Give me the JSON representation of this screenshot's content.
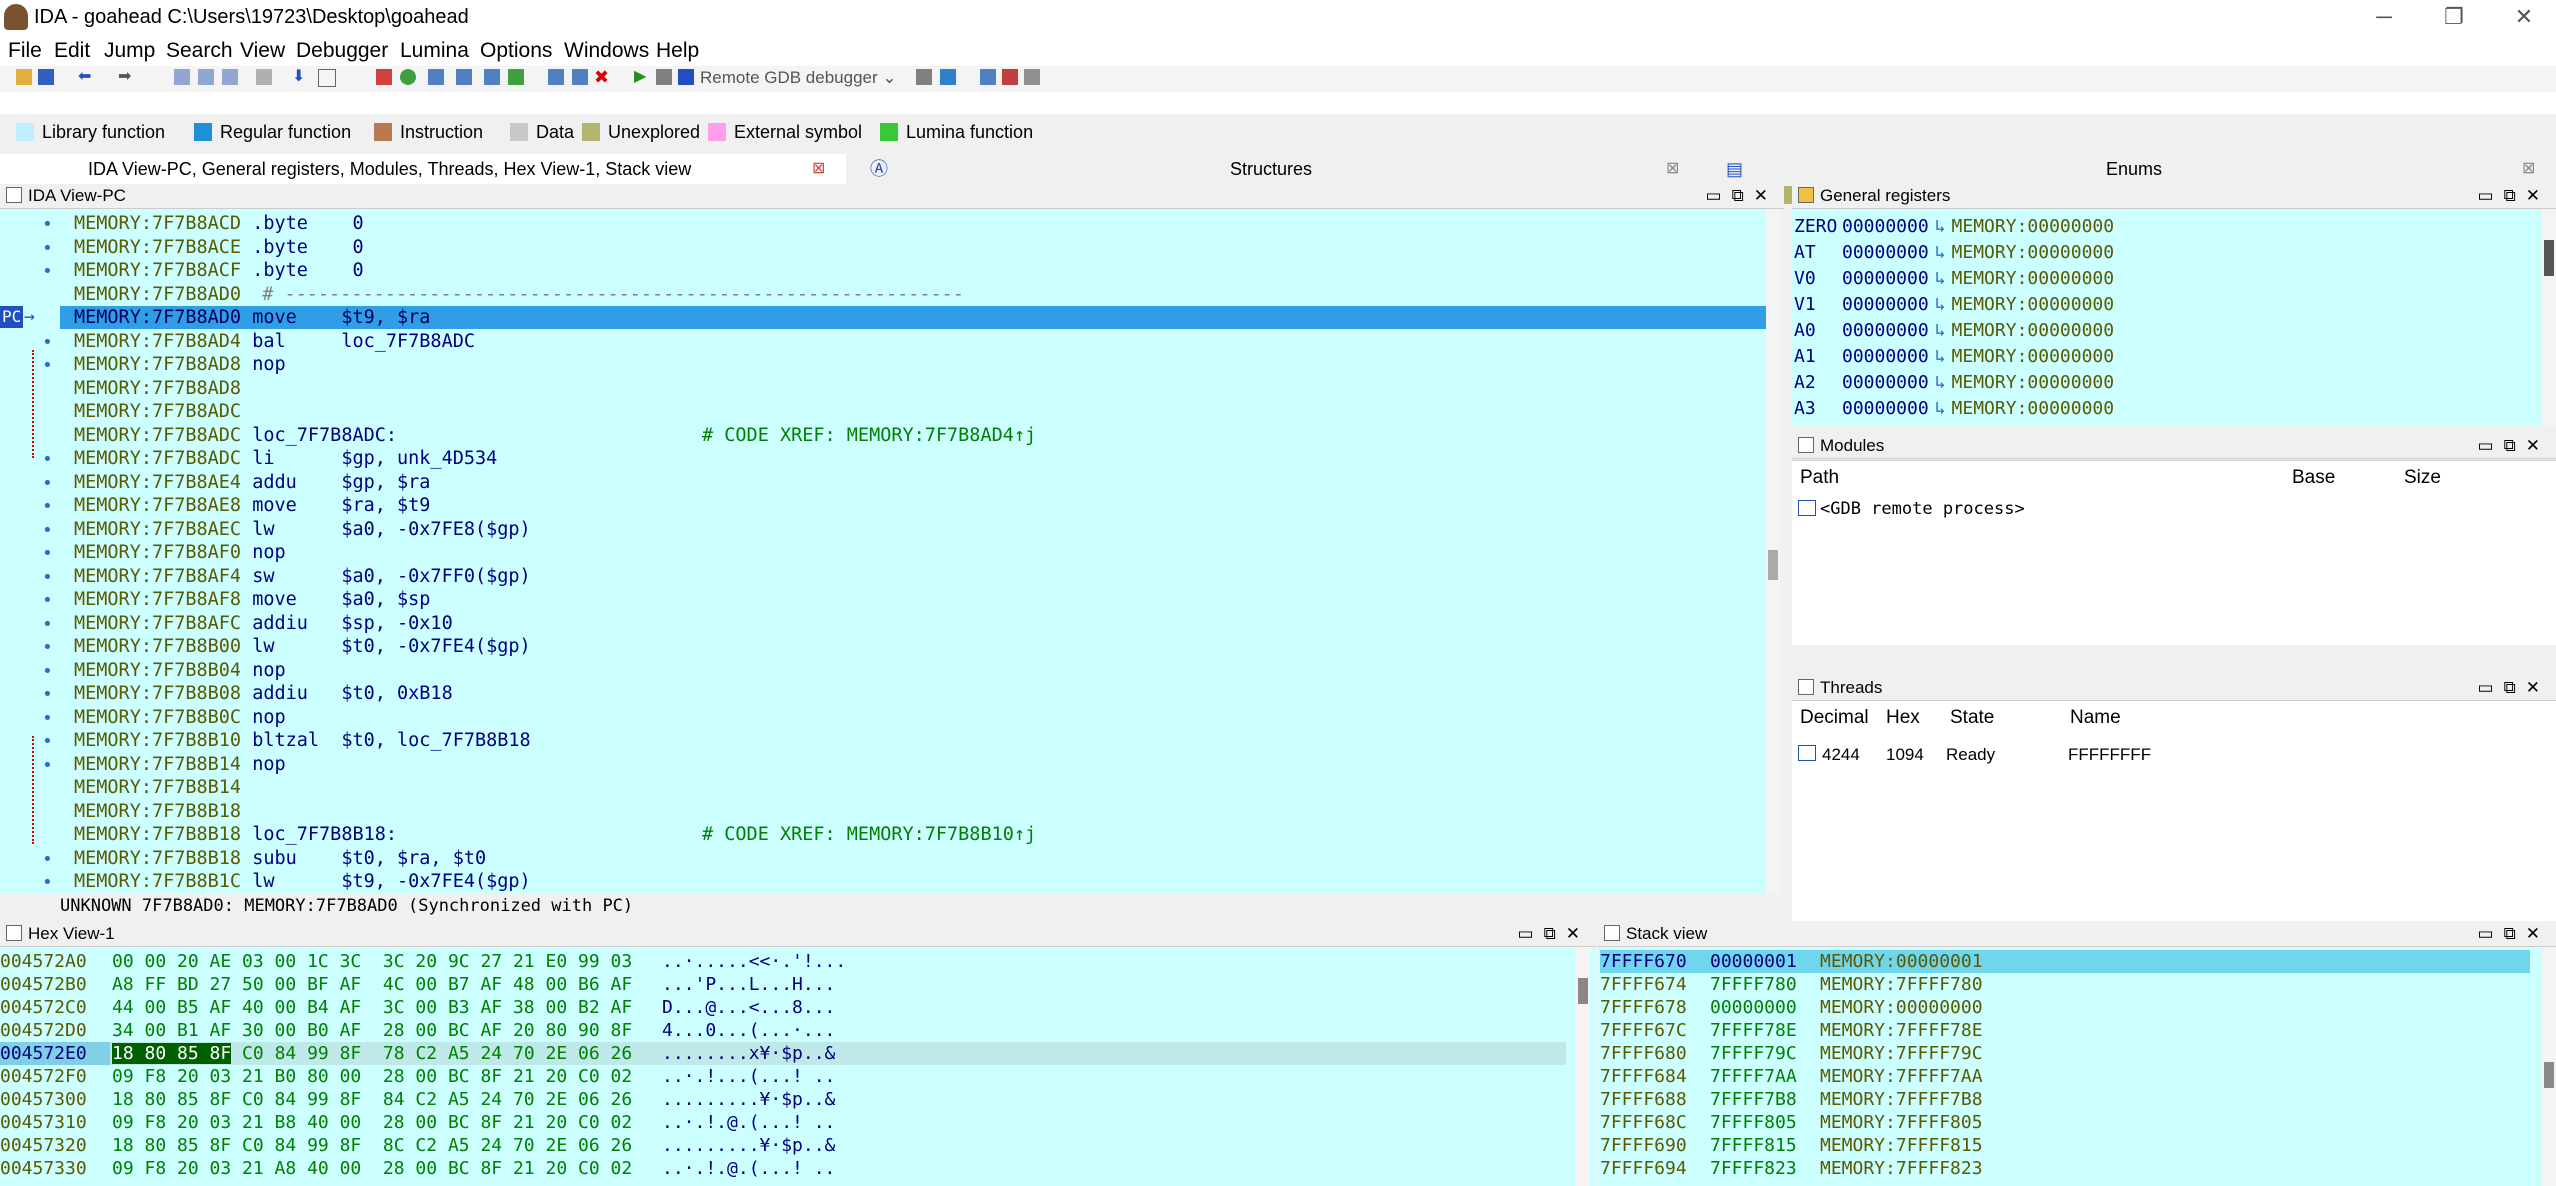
{
  "window": {
    "title": "IDA - goahead C:\\Users\\19723\\Desktop\\goahead",
    "minimize_glyph": "─",
    "maximize_glyph": "❐",
    "close_glyph": "✕"
  },
  "menu": [
    "File",
    "Edit",
    "Jump",
    "Search",
    "View",
    "Debugger",
    "Lumina",
    "Options",
    "Windows",
    "Help"
  ],
  "toolbar": {
    "debugger_label": "Remote GDB debugger"
  },
  "legend": [
    {
      "label": "Library function",
      "color": "#c0f0ff"
    },
    {
      "label": "Regular function",
      "color": "#1e90d8"
    },
    {
      "label": "Instruction",
      "color": "#b87850"
    },
    {
      "label": "Data",
      "color": "#c8c8c8"
    },
    {
      "label": "Unexplored",
      "color": "#b4b46e"
    },
    {
      "label": "External symbol",
      "color": "#ff9eec"
    },
    {
      "label": "Lumina function",
      "color": "#38c838"
    }
  ],
  "tabs": [
    {
      "label": "IDA View-PC, General registers, Modules, Threads, Hex View-1, Stack view"
    },
    {
      "label": "Structures"
    },
    {
      "label": "Enums"
    }
  ],
  "ida_view": {
    "title": "IDA View-PC",
    "pc_label": "PC",
    "status": "UNKNOWN 7F7B8AD0: MEMORY:7F7B8AD0 (Synchronized with PC)",
    "lines": [
      {
        "addr": "MEMORY:7F7B8ACD",
        "instr": ".byte    0",
        "cmt": ""
      },
      {
        "addr": "MEMORY:7F7B8ACE",
        "instr": ".byte    0",
        "cmt": ""
      },
      {
        "addr": "MEMORY:7F7B8ACF",
        "instr": ".byte    0",
        "cmt": ""
      },
      {
        "addr": "MEMORY:7F7B8AD0",
        "instr": "",
        "cmt": "# -------------------------------------------------------------"
      },
      {
        "addr": "MEMORY:7F7B8AD0",
        "instr": "move    $t9, $ra",
        "cmt": ""
      },
      {
        "addr": "MEMORY:7F7B8AD4",
        "instr": "bal     loc_7F7B8ADC",
        "cmt": ""
      },
      {
        "addr": "MEMORY:7F7B8AD8",
        "instr": "nop",
        "cmt": ""
      },
      {
        "addr": "MEMORY:7F7B8AD8",
        "instr": "",
        "cmt": ""
      },
      {
        "addr": "MEMORY:7F7B8ADC",
        "instr": "",
        "cmt": ""
      },
      {
        "addr": "MEMORY:7F7B8ADC",
        "instr": "loc_7F7B8ADC:",
        "cmt": "# CODE XREF: MEMORY:7F7B8AD4↑j"
      },
      {
        "addr": "MEMORY:7F7B8ADC",
        "instr": "li      $gp, unk_4D534",
        "cmt": ""
      },
      {
        "addr": "MEMORY:7F7B8AE4",
        "instr": "addu    $gp, $ra",
        "cmt": ""
      },
      {
        "addr": "MEMORY:7F7B8AE8",
        "instr": "move    $ra, $t9",
        "cmt": ""
      },
      {
        "addr": "MEMORY:7F7B8AEC",
        "instr": "lw      $a0, -0x7FE8($gp)",
        "cmt": ""
      },
      {
        "addr": "MEMORY:7F7B8AF0",
        "instr": "nop",
        "cmt": ""
      },
      {
        "addr": "MEMORY:7F7B8AF4",
        "instr": "sw      $a0, -0x7FF0($gp)",
        "cmt": ""
      },
      {
        "addr": "MEMORY:7F7B8AF8",
        "instr": "move    $a0, $sp",
        "cmt": ""
      },
      {
        "addr": "MEMORY:7F7B8AFC",
        "instr": "addiu   $sp, -0x10",
        "cmt": ""
      },
      {
        "addr": "MEMORY:7F7B8B00",
        "instr": "lw      $t0, -0x7FE4($gp)",
        "cmt": ""
      },
      {
        "addr": "MEMORY:7F7B8B04",
        "instr": "nop",
        "cmt": ""
      },
      {
        "addr": "MEMORY:7F7B8B08",
        "instr": "addiu   $t0, 0xB18",
        "cmt": ""
      },
      {
        "addr": "MEMORY:7F7B8B0C",
        "instr": "nop",
        "cmt": ""
      },
      {
        "addr": "MEMORY:7F7B8B10",
        "instr": "bltzal  $t0, loc_7F7B8B18",
        "cmt": ""
      },
      {
        "addr": "MEMORY:7F7B8B14",
        "instr": "nop",
        "cmt": ""
      },
      {
        "addr": "MEMORY:7F7B8B14",
        "instr": "",
        "cmt": ""
      },
      {
        "addr": "MEMORY:7F7B8B18",
        "instr": "",
        "cmt": ""
      },
      {
        "addr": "MEMORY:7F7B8B18",
        "instr": "loc_7F7B8B18:",
        "cmt": "# CODE XREF: MEMORY:7F7B8B10↑j"
      },
      {
        "addr": "MEMORY:7F7B8B18",
        "instr": "subu    $t0, $ra, $t0",
        "cmt": ""
      },
      {
        "addr": "MEMORY:7F7B8B1C",
        "instr": "lw      $t9, -0x7FE4($gp)",
        "cmt": ""
      }
    ]
  },
  "registers": {
    "title": "General registers",
    "rows": [
      {
        "name": "ZERO",
        "value": "00000000",
        "ref": "MEMORY:00000000"
      },
      {
        "name": "AT",
        "value": "00000000",
        "ref": "MEMORY:00000000"
      },
      {
        "name": "V0",
        "value": "00000000",
        "ref": "MEMORY:00000000"
      },
      {
        "name": "V1",
        "value": "00000000",
        "ref": "MEMORY:00000000"
      },
      {
        "name": "A0",
        "value": "00000000",
        "ref": "MEMORY:00000000"
      },
      {
        "name": "A1",
        "value": "00000000",
        "ref": "MEMORY:00000000"
      },
      {
        "name": "A2",
        "value": "00000000",
        "ref": "MEMORY:00000000"
      },
      {
        "name": "A3",
        "value": "00000000",
        "ref": "MEMORY:00000000"
      }
    ]
  },
  "modules": {
    "title": "Modules",
    "columns": [
      "Path",
      "Base",
      "Size"
    ],
    "rows": [
      {
        "path": "<GDB remote process>"
      }
    ]
  },
  "threads": {
    "title": "Threads",
    "columns": [
      "Decimal",
      "Hex",
      "State",
      "Name"
    ],
    "rows": [
      {
        "decimal": "4244",
        "hex": "1094",
        "state": "Ready",
        "name": "FFFFFFFF"
      }
    ]
  },
  "hex_view": {
    "title": "Hex View-1",
    "rows": [
      {
        "addr": "004572A0",
        "bytes": "00 00 20 AE 03 00 1C 3C  3C 20 9C 27 21 E0 99 03",
        "ascii": "..·.....<<·.'!..."
      },
      {
        "addr": "004572B0",
        "bytes": "A8 FF BD 27 50 00 BF AF  4C 00 B7 AF 48 00 B6 AF",
        "ascii": "...'P...L...H..."
      },
      {
        "addr": "004572C0",
        "bytes": "44 00 B5 AF 40 00 B4 AF  3C 00 B3 AF 38 00 B2 AF",
        "ascii": "D...@...<...8..."
      },
      {
        "addr": "004572D0",
        "bytes": "34 00 B1 AF 30 00 B0 AF  28 00 BC AF 20 80 90 8F",
        "ascii": "4...0...(...·..."
      },
      {
        "addr": "004572E0",
        "hl": "18 80 85 8F",
        "bytes": " C0 84 99 8F  78 C2 A5 24 70 2E 06 26",
        "ascii": "........x¥·$p..&"
      },
      {
        "addr": "004572F0",
        "bytes": "09 F8 20 03 21 B0 80 00  28 00 BC 8F 21 20 C0 02",
        "ascii": "..·.!...(...! .."
      },
      {
        "addr": "00457300",
        "bytes": "18 80 85 8F C0 84 99 8F  84 C2 A5 24 70 2E 06 26",
        "ascii": ".........¥·$p..&"
      },
      {
        "addr": "00457310",
        "bytes": "09 F8 20 03 21 B8 40 00  28 00 BC 8F 21 20 C0 02",
        "ascii": "..·.!.@.(...! .."
      },
      {
        "addr": "00457320",
        "bytes": "18 80 85 8F C0 84 99 8F  8C C2 A5 24 70 2E 06 26",
        "ascii": ".........¥·$p..&"
      },
      {
        "addr": "00457330",
        "bytes": "09 F8 20 03 21 A8 40 00  28 00 BC 8F 21 20 C0 02",
        "ascii": "..·.!.@.(...! .."
      }
    ]
  },
  "stack_view": {
    "title": "Stack view",
    "rows": [
      {
        "addr": "7FFFF670",
        "value": "00000001",
        "ref": "MEMORY:00000001"
      },
      {
        "addr": "7FFFF674",
        "value": "7FFFF780",
        "ref": "MEMORY:7FFFF780"
      },
      {
        "addr": "7FFFF678",
        "value": "00000000",
        "ref": "MEMORY:00000000"
      },
      {
        "addr": "7FFFF67C",
        "value": "7FFFF78E",
        "ref": "MEMORY:7FFFF78E"
      },
      {
        "addr": "7FFFF680",
        "value": "7FFFF79C",
        "ref": "MEMORY:7FFFF79C"
      },
      {
        "addr": "7FFFF684",
        "value": "7FFFF7AA",
        "ref": "MEMORY:7FFFF7AA"
      },
      {
        "addr": "7FFFF688",
        "value": "7FFFF7B8",
        "ref": "MEMORY:7FFFF7B8"
      },
      {
        "addr": "7FFFF68C",
        "value": "7FFFF805",
        "ref": "MEMORY:7FFFF805"
      },
      {
        "addr": "7FFFF690",
        "value": "7FFFF815",
        "ref": "MEMORY:7FFFF815"
      },
      {
        "addr": "7FFFF694",
        "value": "7FFFF823",
        "ref": "MEMORY:7FFFF823"
      }
    ]
  }
}
